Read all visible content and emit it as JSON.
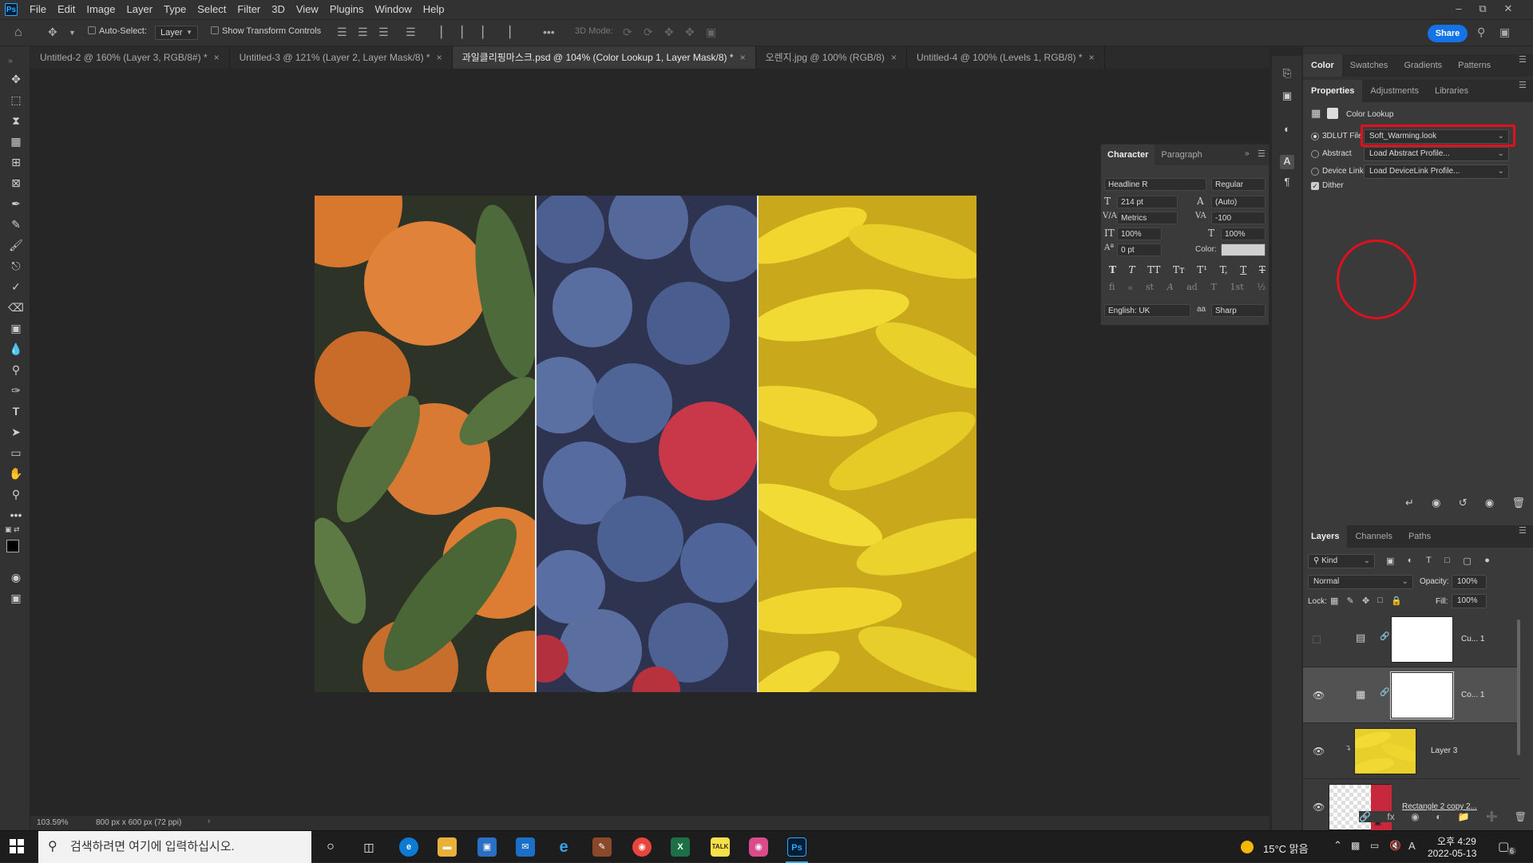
{
  "app": {
    "logo": "Ps",
    "accent": "#31a8ff",
    "share_label": "Share"
  },
  "menu": [
    "File",
    "Edit",
    "Image",
    "Layer",
    "Type",
    "Select",
    "Filter",
    "3D",
    "View",
    "Plugins",
    "Window",
    "Help"
  ],
  "options": {
    "auto_select_label": "Auto-Select:",
    "auto_select_checked": false,
    "layer_combo": "Layer",
    "show_transform_label": "Show Transform Controls",
    "mode_3d_label": "3D Mode:"
  },
  "tabs": [
    {
      "label": "Untitled-2 @ 160% (Layer 3, RGB/8#) *",
      "active": false
    },
    {
      "label": "Untitled-3 @ 121% (Layer 2, Layer Mask/8) *",
      "active": false
    },
    {
      "label": "과일클리핑마스크.psd @ 104% (Color Lookup 1, Layer Mask/8) *",
      "active": true
    },
    {
      "label": "오렌지.jpg @ 100% (RGB/8)",
      "active": false
    },
    {
      "label": "Untitled-4 @ 100% (Levels 1, RGB/8) *",
      "active": false
    }
  ],
  "status": {
    "zoom": "103.59%",
    "doc_info": "800 px x 600 px (72 ppi)"
  },
  "canvas_image": {
    "panels": [
      "oranges",
      "blueberries",
      "bananas"
    ]
  },
  "character": {
    "tabs": [
      "Character",
      "Paragraph"
    ],
    "font_family": "Headline R",
    "font_style": "Regular",
    "size": "214 pt",
    "leading": "(Auto)",
    "kerning": "Metrics",
    "tracking": "-100",
    "vscale": "100%",
    "hscale": "100%",
    "baseline": "0 pt",
    "color_label": "Color:",
    "language": "English: UK",
    "aa_label": "aa",
    "antialias": "Sharp",
    "style_buttons": [
      "T",
      "T",
      "TT",
      "Tт",
      "T¹",
      "T,",
      "T",
      "T"
    ],
    "opentype_buttons": [
      "fi",
      "ℴ",
      "st",
      "A",
      "ad",
      "T",
      "1st",
      "½"
    ]
  },
  "right_panels": {
    "color_tabs": [
      "Color",
      "Swatches",
      "Gradients",
      "Patterns"
    ],
    "props_tabs": [
      "Properties",
      "Adjustments",
      "Libraries"
    ],
    "properties": {
      "title": "Color Lookup",
      "options": [
        {
          "label": "3DLUT File",
          "value": "Soft_Warming.look",
          "selected": true
        },
        {
          "label": "Abstract",
          "value": "Load Abstract Profile...",
          "selected": false
        },
        {
          "label": "Device Link",
          "value": "Load DeviceLink Profile...",
          "selected": false
        }
      ],
      "dither_label": "Dither",
      "dither_checked": true,
      "highlight_color": "#e0101e"
    },
    "layers_tabs": [
      "Layers",
      "Channels",
      "Paths"
    ],
    "layers": {
      "filter": "Kind",
      "blend_mode": "Normal",
      "opacity_label": "Opacity:",
      "opacity": "100%",
      "lock_label": "Lock:",
      "fill_label": "Fill:",
      "fill": "100%",
      "items": [
        {
          "name": "Cu... 1",
          "visible": false,
          "type": "adjustment",
          "icon": "curves-icon"
        },
        {
          "name": "Co... 1",
          "visible": true,
          "type": "adjustment",
          "icon": "color-lookup-icon",
          "selected": true
        },
        {
          "name": "Layer 3",
          "visible": true,
          "type": "pixel"
        },
        {
          "name": "Rectangle 2 copy 2...",
          "visible": true,
          "type": "shape"
        }
      ]
    }
  },
  "taskbar": {
    "search_placeholder": "검색하려면 여기에 입력하십시오.",
    "weather": "15°C 맑음",
    "ime": "A",
    "time": "오후 4:29",
    "date": "2022-05-13",
    "notifications": "6"
  }
}
